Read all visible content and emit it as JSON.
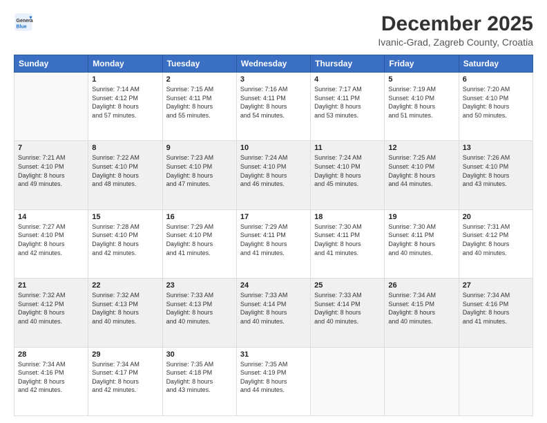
{
  "logo": {
    "line1": "General",
    "line2": "Blue"
  },
  "title": "December 2025",
  "subtitle": "Ivanic-Grad, Zagreb County, Croatia",
  "weekdays": [
    "Sunday",
    "Monday",
    "Tuesday",
    "Wednesday",
    "Thursday",
    "Friday",
    "Saturday"
  ],
  "weeks": [
    [
      {
        "day": "",
        "info": ""
      },
      {
        "day": "1",
        "info": "Sunrise: 7:14 AM\nSunset: 4:12 PM\nDaylight: 8 hours\nand 57 minutes."
      },
      {
        "day": "2",
        "info": "Sunrise: 7:15 AM\nSunset: 4:11 PM\nDaylight: 8 hours\nand 55 minutes."
      },
      {
        "day": "3",
        "info": "Sunrise: 7:16 AM\nSunset: 4:11 PM\nDaylight: 8 hours\nand 54 minutes."
      },
      {
        "day": "4",
        "info": "Sunrise: 7:17 AM\nSunset: 4:11 PM\nDaylight: 8 hours\nand 53 minutes."
      },
      {
        "day": "5",
        "info": "Sunrise: 7:19 AM\nSunset: 4:10 PM\nDaylight: 8 hours\nand 51 minutes."
      },
      {
        "day": "6",
        "info": "Sunrise: 7:20 AM\nSunset: 4:10 PM\nDaylight: 8 hours\nand 50 minutes."
      }
    ],
    [
      {
        "day": "7",
        "info": "Sunrise: 7:21 AM\nSunset: 4:10 PM\nDaylight: 8 hours\nand 49 minutes."
      },
      {
        "day": "8",
        "info": "Sunrise: 7:22 AM\nSunset: 4:10 PM\nDaylight: 8 hours\nand 48 minutes."
      },
      {
        "day": "9",
        "info": "Sunrise: 7:23 AM\nSunset: 4:10 PM\nDaylight: 8 hours\nand 47 minutes."
      },
      {
        "day": "10",
        "info": "Sunrise: 7:24 AM\nSunset: 4:10 PM\nDaylight: 8 hours\nand 46 minutes."
      },
      {
        "day": "11",
        "info": "Sunrise: 7:24 AM\nSunset: 4:10 PM\nDaylight: 8 hours\nand 45 minutes."
      },
      {
        "day": "12",
        "info": "Sunrise: 7:25 AM\nSunset: 4:10 PM\nDaylight: 8 hours\nand 44 minutes."
      },
      {
        "day": "13",
        "info": "Sunrise: 7:26 AM\nSunset: 4:10 PM\nDaylight: 8 hours\nand 43 minutes."
      }
    ],
    [
      {
        "day": "14",
        "info": "Sunrise: 7:27 AM\nSunset: 4:10 PM\nDaylight: 8 hours\nand 42 minutes."
      },
      {
        "day": "15",
        "info": "Sunrise: 7:28 AM\nSunset: 4:10 PM\nDaylight: 8 hours\nand 42 minutes."
      },
      {
        "day": "16",
        "info": "Sunrise: 7:29 AM\nSunset: 4:10 PM\nDaylight: 8 hours\nand 41 minutes."
      },
      {
        "day": "17",
        "info": "Sunrise: 7:29 AM\nSunset: 4:11 PM\nDaylight: 8 hours\nand 41 minutes."
      },
      {
        "day": "18",
        "info": "Sunrise: 7:30 AM\nSunset: 4:11 PM\nDaylight: 8 hours\nand 41 minutes."
      },
      {
        "day": "19",
        "info": "Sunrise: 7:30 AM\nSunset: 4:11 PM\nDaylight: 8 hours\nand 40 minutes."
      },
      {
        "day": "20",
        "info": "Sunrise: 7:31 AM\nSunset: 4:12 PM\nDaylight: 8 hours\nand 40 minutes."
      }
    ],
    [
      {
        "day": "21",
        "info": "Sunrise: 7:32 AM\nSunset: 4:12 PM\nDaylight: 8 hours\nand 40 minutes."
      },
      {
        "day": "22",
        "info": "Sunrise: 7:32 AM\nSunset: 4:13 PM\nDaylight: 8 hours\nand 40 minutes."
      },
      {
        "day": "23",
        "info": "Sunrise: 7:33 AM\nSunset: 4:13 PM\nDaylight: 8 hours\nand 40 minutes."
      },
      {
        "day": "24",
        "info": "Sunrise: 7:33 AM\nSunset: 4:14 PM\nDaylight: 8 hours\nand 40 minutes."
      },
      {
        "day": "25",
        "info": "Sunrise: 7:33 AM\nSunset: 4:14 PM\nDaylight: 8 hours\nand 40 minutes."
      },
      {
        "day": "26",
        "info": "Sunrise: 7:34 AM\nSunset: 4:15 PM\nDaylight: 8 hours\nand 40 minutes."
      },
      {
        "day": "27",
        "info": "Sunrise: 7:34 AM\nSunset: 4:16 PM\nDaylight: 8 hours\nand 41 minutes."
      }
    ],
    [
      {
        "day": "28",
        "info": "Sunrise: 7:34 AM\nSunset: 4:16 PM\nDaylight: 8 hours\nand 42 minutes."
      },
      {
        "day": "29",
        "info": "Sunrise: 7:34 AM\nSunset: 4:17 PM\nDaylight: 8 hours\nand 42 minutes."
      },
      {
        "day": "30",
        "info": "Sunrise: 7:35 AM\nSunset: 4:18 PM\nDaylight: 8 hours\nand 43 minutes."
      },
      {
        "day": "31",
        "info": "Sunrise: 7:35 AM\nSunset: 4:19 PM\nDaylight: 8 hours\nand 44 minutes."
      },
      {
        "day": "",
        "info": ""
      },
      {
        "day": "",
        "info": ""
      },
      {
        "day": "",
        "info": ""
      }
    ]
  ]
}
